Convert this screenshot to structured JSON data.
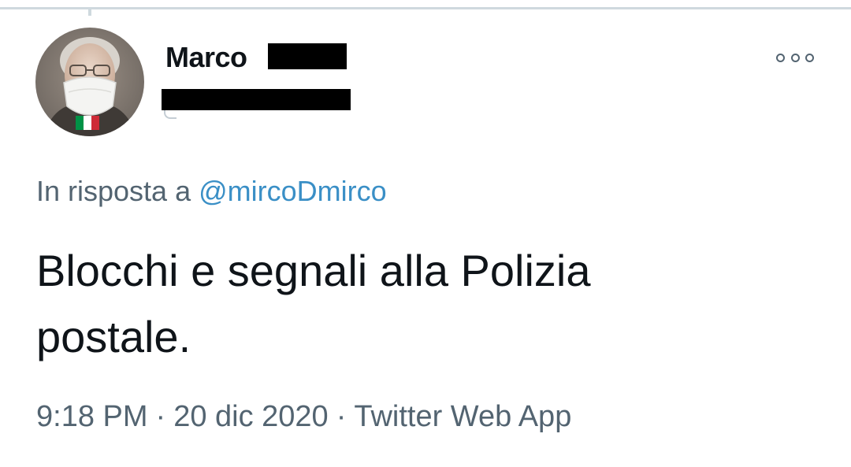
{
  "tweet": {
    "author": {
      "name_prefix": "Marco",
      "name_redacted": true,
      "handle_redacted": true
    },
    "reply_context": {
      "prefix": "In risposta a",
      "mention": "@mircoDmirco"
    },
    "text": "Blocchi e segnali alla Polizia postale.",
    "meta": {
      "time": "9:18 PM",
      "separator": "·",
      "date": "20 dic 2020",
      "source": "Twitter Web App"
    }
  },
  "icons": {
    "more": "more-options-icon",
    "flag": "italy-flag-icon"
  },
  "colors": {
    "text_primary": "#0f1419",
    "text_secondary": "#536471",
    "mention": "#3a8fc6",
    "divider": "#cfd9de",
    "flag_green": "#009246",
    "flag_white": "#ffffff",
    "flag_red": "#ce2b37"
  }
}
